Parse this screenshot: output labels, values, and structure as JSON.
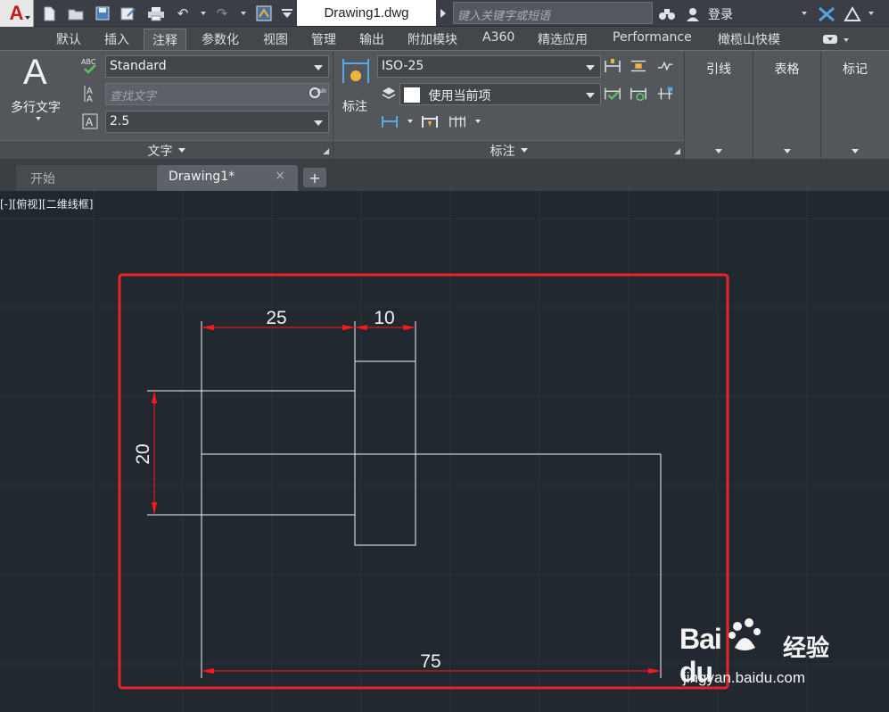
{
  "app": {
    "logo": "A",
    "document_title": "Drawing1.dwg",
    "search_placeholder": "键入关键字或短语",
    "login_label": "登录"
  },
  "ribbon_tabs": [
    "默认",
    "插入",
    "注释",
    "参数化",
    "视图",
    "管理",
    "输出",
    "附加模块",
    "A360",
    "精选应用",
    "Performance",
    "橄榄山快模"
  ],
  "active_ribbon_tab": "注释",
  "text_panel": {
    "mtext_icon": "A",
    "mtext_label": "多行文字",
    "text_style": "Standard",
    "find_placeholder": "查找文字",
    "text_height": "2.5",
    "footer": "文字"
  },
  "dim_panel": {
    "dim_label": "标注",
    "dim_style": "ISO-25",
    "layer": "使用当前项",
    "footer": "标注"
  },
  "side_panels": [
    "引线",
    "表格",
    "标记"
  ],
  "file_tabs": {
    "start": "开始",
    "doc": "Drawing1*",
    "close": "×",
    "plus": "+"
  },
  "viewport": {
    "label": "[-][俯视][二维线框]"
  },
  "dimensions": {
    "d25": "25",
    "d10": "10",
    "d20": "20",
    "d75": "75"
  },
  "watermark": {
    "brand": "Bai  du",
    "cn": "经验",
    "url": "jingyan.baidu.com"
  },
  "colors": {
    "canvas": "#212830",
    "ribbon": "#53575c",
    "dimension": "#ff1a1a",
    "highlight": "#e8262a"
  }
}
